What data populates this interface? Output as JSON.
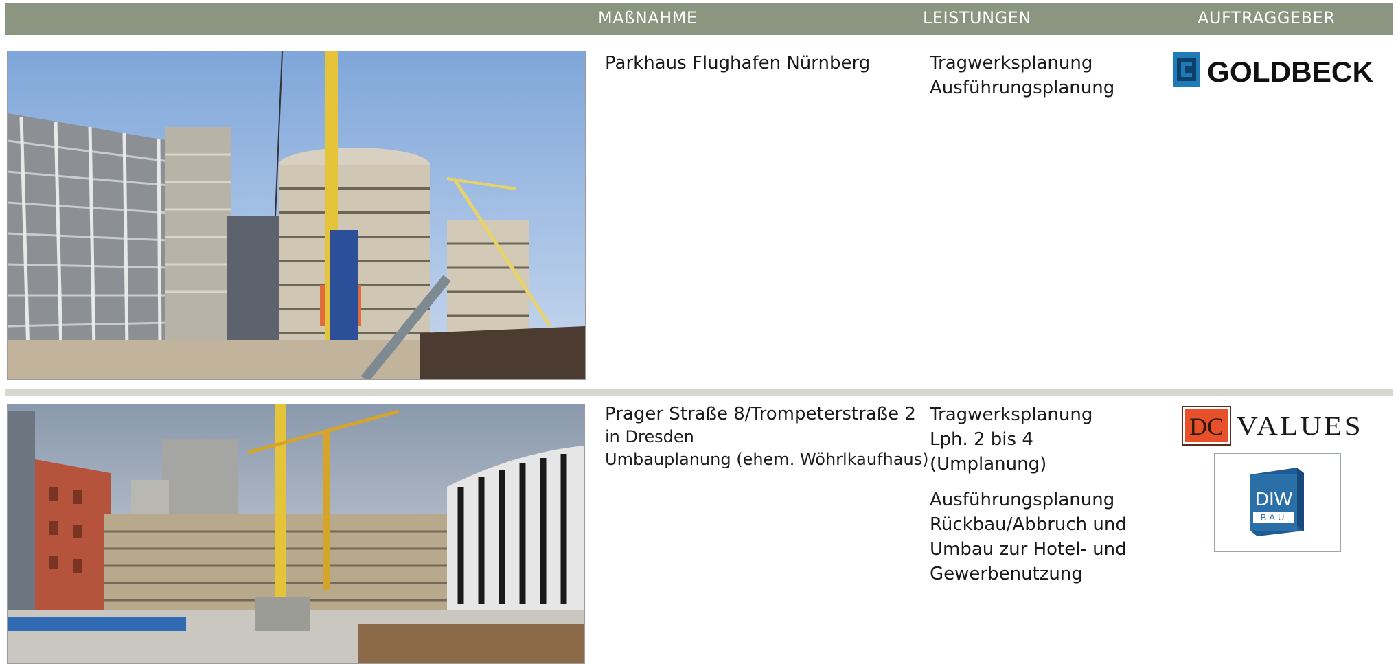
{
  "header": {
    "massnahme": "MAßNAHME",
    "leistungen": "LEISTUNGEN",
    "auftraggeber": "AUFTRAGGEBER"
  },
  "rows": [
    {
      "massnahme": [
        "Parkhaus Flughafen Nürnberg"
      ],
      "leistungen": [
        "Tragwerksplanung",
        "Ausführungsplanung"
      ],
      "auftraggeber_logo": "GOLDBECK"
    },
    {
      "massnahme": [
        "Prager Straße 8/Trompeterstraße 2",
        "in Dresden",
        "Umbauplanung (ehem. Wöhrlkaufhaus)"
      ],
      "leistungen_block1": [
        "Tragwerksplanung",
        "Lph. 2 bis 4",
        "(Umplanung)"
      ],
      "leistungen_block2": [
        "Ausführungsplanung",
        "Rückbau/Abbruch und",
        "Umbau zur Hotel- und",
        "Gewerbenutzung"
      ],
      "auftraggeber_logo_1_initials": "DC",
      "auftraggeber_logo_1_name": "VALUES",
      "auftraggeber_logo_2_name": "DIW",
      "auftraggeber_logo_2_sub": "BAU"
    }
  ],
  "colors": {
    "header_bg": "#8a9680",
    "divider": "#d6d8d2",
    "goldbeck_blue": "#1f7ab8",
    "dc_orange": "#e8502a",
    "diw_blue": "#2a6fa8"
  }
}
